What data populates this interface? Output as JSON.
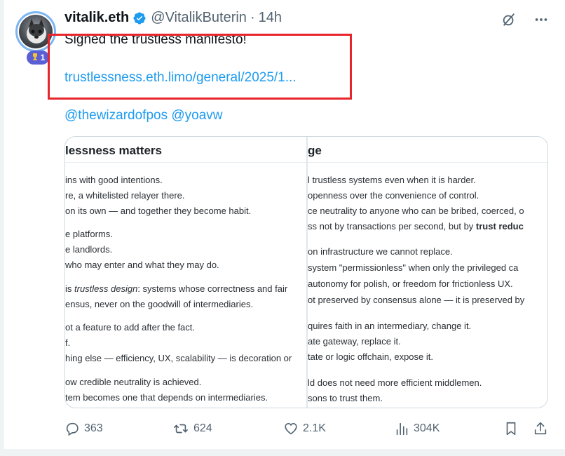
{
  "tweet": {
    "author_name": "vitalik.eth",
    "author_handle": "@VitalikButerin",
    "separator": "·",
    "time": "14h",
    "badge_count": "1",
    "text": "Signed the trustless manifesto!",
    "link": "trustlessness.eth.limo/general/2025/1...",
    "mentions": "@thewizardofpos @yoavw"
  },
  "icons": {
    "verified": "verified-badge-icon",
    "grok": "grok-icon",
    "more": "more-icon",
    "trophy": "trophy-icon",
    "reply": "reply-icon",
    "retweet": "retweet-icon",
    "like": "like-icon",
    "views": "views-icon",
    "bookmark": "bookmark-icon",
    "share": "share-icon"
  },
  "colors": {
    "accent": "#1d9bf0",
    "highlight_box": "#e8252b",
    "secondary_text": "#536471"
  },
  "image_card": {
    "left_panel": {
      "heading": "lessness matters",
      "lines": [
        "ins with good intentions.",
        "re, a whitelisted relayer there.",
        "on its own — and together they become habit.",
        "e platforms.",
        "e landlords.",
        "who may enter and what they may do.",
        "is ",
        "trustless design",
        ": systems whose correctness and fair",
        "ensus, never on the goodwill of intermediaries.",
        "ot a feature to add after the fact.",
        "f.",
        "hing else — efficiency, UX, scalability — is decoration or",
        "ow credible neutrality is achieved.",
        "tem becomes one that depends on intermediaries."
      ]
    },
    "right_panel": {
      "heading": "ge",
      "lines": [
        "l trustless systems even when it is harder.",
        " openness over the convenience of control.",
        "ce neutrality to anyone who can be bribed, coerced, o",
        "ss not by transactions per second, but by ",
        "trust reduc",
        "on infrastructure we cannot replace.",
        " system \"permissionless\" when only the privileged ca",
        " autonomy for polish, or freedom for frictionless UX.",
        "ot preserved by consensus alone — it is preserved by",
        "quires faith in an intermediary, change it.",
        "ate gateway, replace it.",
        "tate or logic offchain, expose it.",
        "ld does not need more efficient middlemen.",
        "sons to trust them."
      ]
    }
  },
  "actions": {
    "replies": "363",
    "reposts": "624",
    "likes": "2.1K",
    "views": "304K"
  }
}
